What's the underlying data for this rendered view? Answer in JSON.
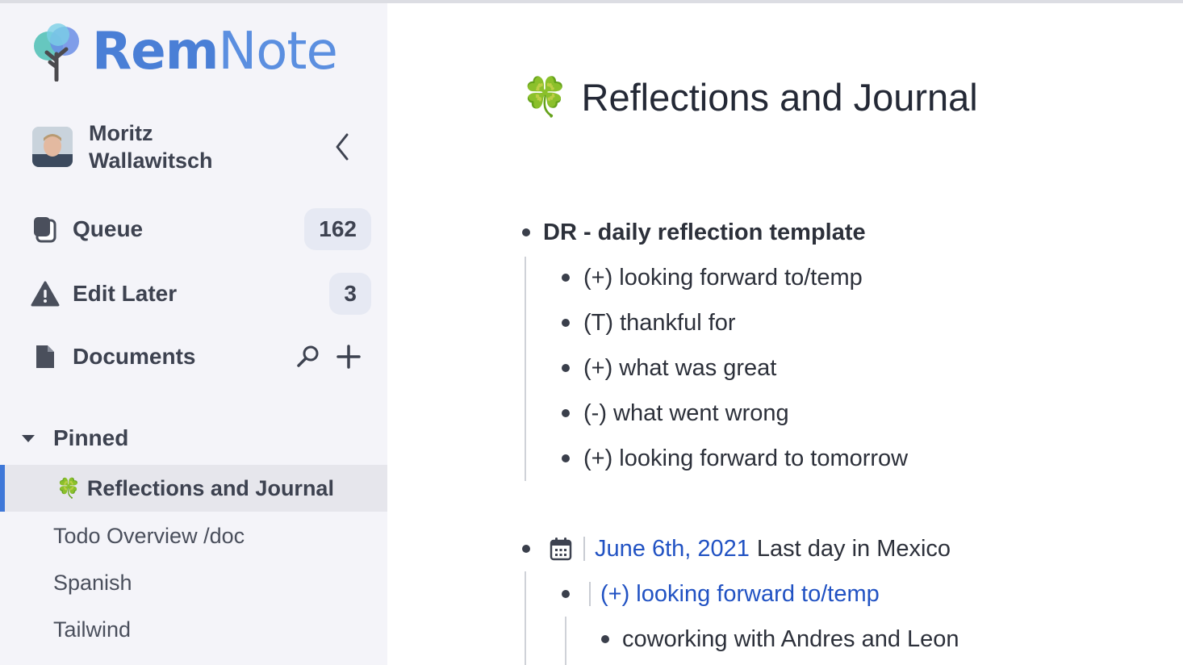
{
  "app": {
    "logo_rem": "Rem",
    "logo_note": "Note",
    "brand_color": "#4a7fd6"
  },
  "user": {
    "name_line1": "Moritz",
    "name_line2": "Wallawitsch"
  },
  "nav": {
    "queue": {
      "label": "Queue",
      "count": "162",
      "icon": "cards-icon"
    },
    "edit_later": {
      "label": "Edit Later",
      "count": "3",
      "icon": "warning-icon"
    },
    "documents": {
      "label": "Documents",
      "icon": "document-icon"
    }
  },
  "pinned": {
    "header": "Pinned",
    "items": [
      {
        "emoji": "🍀",
        "label": "Reflections and Journal",
        "active": true
      },
      {
        "label": "Todo Overview /doc"
      },
      {
        "label": "Spanish"
      },
      {
        "label": "Tailwind"
      }
    ]
  },
  "document": {
    "emoji": "🍀",
    "title": "Reflections and Journal",
    "template": {
      "heading": "DR - daily reflection template",
      "children": [
        "(+) looking forward to/temp",
        "(T) thankful for",
        "(+) what was great",
        "(-) what went wrong",
        "(+) looking forward to tomorrow"
      ]
    },
    "entry": {
      "date_link": "June 6th, 2021",
      "date_text": "Last day in Mexico",
      "child_link": "(+) looking forward to/temp",
      "grandchild": "coworking with Andres and Leon"
    }
  }
}
